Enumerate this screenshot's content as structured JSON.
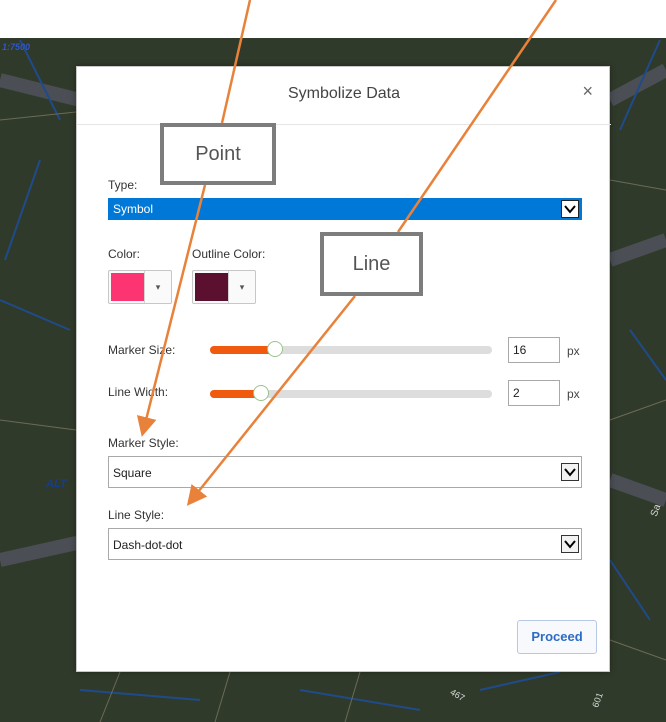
{
  "map": {
    "scale_label": "1:7500",
    "street_label": "ALT",
    "number_467": "467",
    "number_601": "601",
    "side_label": "Sa"
  },
  "dialog": {
    "title": "Symbolize Data",
    "close_glyph": "×",
    "type": {
      "label": "Type:",
      "value": "Symbol"
    },
    "color": {
      "label": "Color:",
      "value": "#fd3472"
    },
    "outline_color": {
      "label": "Outline Color:",
      "value": "#5c1030"
    },
    "dropdown_glyph": "▾",
    "marker_size": {
      "label": "Marker Size:",
      "value": "16",
      "unit": "px",
      "slider_fraction": 0.23
    },
    "line_width": {
      "label": "Line Width:",
      "value": "2",
      "unit": "px",
      "slider_fraction": 0.18
    },
    "marker_style": {
      "label": "Marker Style:",
      "value": "Square"
    },
    "line_style": {
      "label": "Line Style:",
      "value": "Dash-dot-dot"
    },
    "proceed_label": "Proceed"
  },
  "callouts": {
    "point": "Point",
    "line": "Line"
  },
  "colors": {
    "accent": "#0078d7",
    "slider_fill": "#f05a0f",
    "arrow": "#e8823a",
    "map_roads": "#1f4b8a"
  }
}
